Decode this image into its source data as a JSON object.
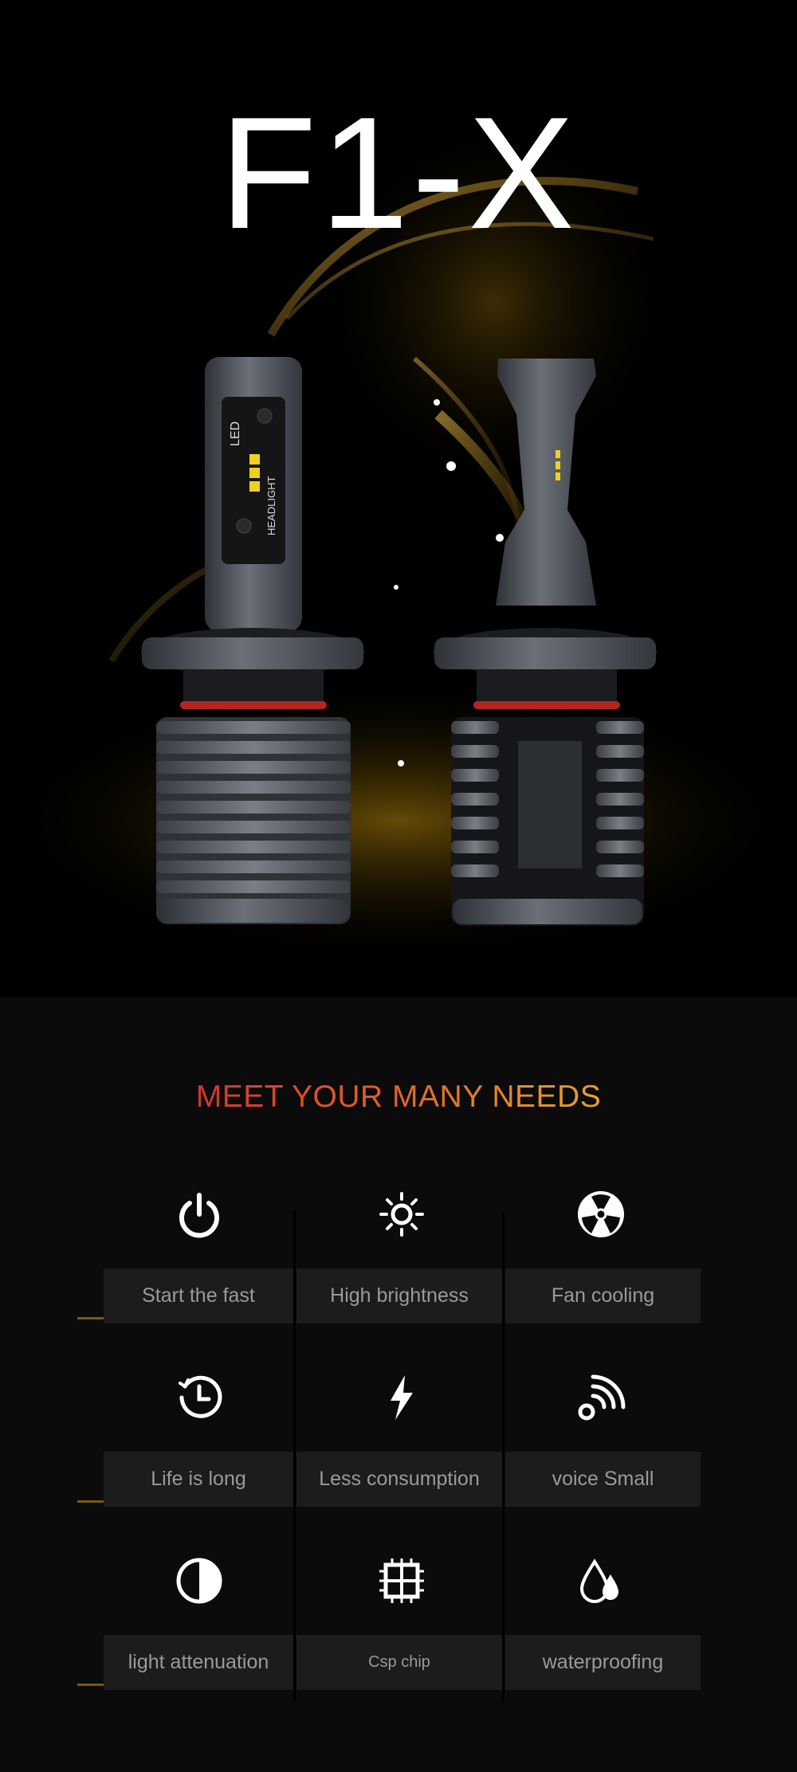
{
  "hero": {
    "title": "F1-X",
    "bulb_left_text_1": "LED",
    "bulb_left_text_2": "HEADLIGHT"
  },
  "features": {
    "title": "MEET YOUR MANY NEEDS",
    "items": [
      {
        "label": "Start the fast",
        "icon": "power-icon"
      },
      {
        "label": "High brightness",
        "icon": "sun-icon"
      },
      {
        "label": "Fan cooling",
        "icon": "fan-icon"
      },
      {
        "label": "Life is long",
        "icon": "clock-icon"
      },
      {
        "label": "Less consumption",
        "icon": "lightning-icon"
      },
      {
        "label": "voice Small",
        "icon": "signal-icon"
      },
      {
        "label": "light attenuation",
        "icon": "contrast-icon"
      },
      {
        "label": "Csp chip",
        "icon": "chip-icon"
      },
      {
        "label": "waterproofing",
        "icon": "water-drops-icon"
      }
    ]
  },
  "colors": {
    "background": "#0b0b0b",
    "title_gradient_start": "#d0352c",
    "title_gradient_end": "#e8a030",
    "label_bg": "#1c1c1c",
    "label_text": "#9a9a9a"
  }
}
